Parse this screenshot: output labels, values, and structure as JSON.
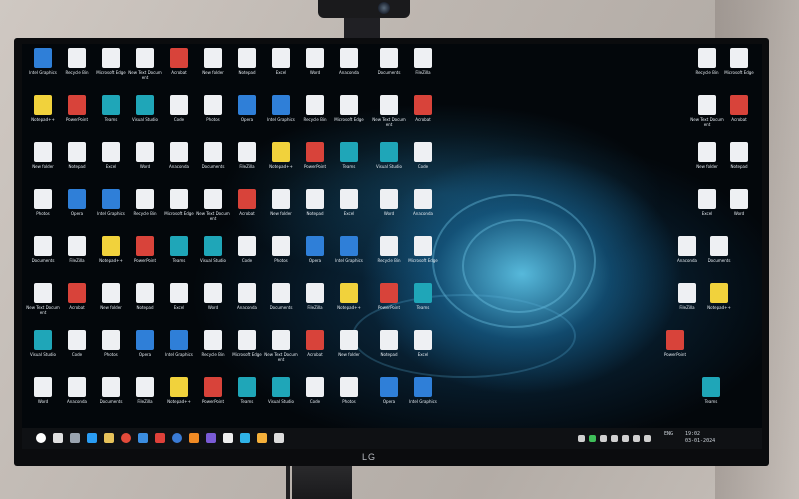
{
  "brand": "LG",
  "taskbar": {
    "icons": [
      {
        "name": "start-icon",
        "color": "#ffffff"
      },
      {
        "name": "search-icon",
        "color": "#e0e0e0"
      },
      {
        "name": "taskview-icon",
        "color": "#9aa4b0"
      },
      {
        "name": "edge-icon",
        "color": "#2a9df4"
      },
      {
        "name": "explorer-icon",
        "color": "#e7c25a"
      },
      {
        "name": "chrome-icon",
        "color": "#e34a3a"
      },
      {
        "name": "mail-icon",
        "color": "#3b8de0"
      },
      {
        "name": "opera-icon",
        "color": "#e0413a"
      },
      {
        "name": "store-icon",
        "color": "#3a7bd5"
      },
      {
        "name": "media-icon",
        "color": "#f08a24"
      },
      {
        "name": "vs-icon",
        "color": "#7a5bd6"
      },
      {
        "name": "app-icon",
        "color": "#eeeeee"
      },
      {
        "name": "browser-icon",
        "color": "#2fb3e8"
      },
      {
        "name": "app2-icon",
        "color": "#f5b03a"
      },
      {
        "name": "app3-icon",
        "color": "#dcdcdc"
      }
    ],
    "tray_icons": [
      {
        "name": "tray-chevron-icon",
        "color": "#d0d0d0"
      },
      {
        "name": "tray-app-icon",
        "color": "#3fbf5a"
      },
      {
        "name": "tray-network-icon",
        "color": "#d0d0d0"
      },
      {
        "name": "tray-volume-icon",
        "color": "#d0d0d0"
      },
      {
        "name": "tray-battery-icon",
        "color": "#d0d0d0"
      },
      {
        "name": "tray-cloud-icon",
        "color": "#d0d0d0"
      },
      {
        "name": "tray-security-icon",
        "color": "#d0d0d0"
      }
    ],
    "lang": "ENG",
    "time": "19:02",
    "date": "03-01-2024"
  },
  "desktop_icons": [
    {
      "label": "Intel Graphics",
      "glyph": "blue"
    },
    {
      "label": "Recycle Bin",
      "glyph": "doc"
    },
    {
      "label": "Microsoft Edge",
      "glyph": "doc"
    },
    {
      "label": "New Text Document",
      "glyph": "doc"
    },
    {
      "label": "Acrobat",
      "glyph": "red"
    },
    {
      "label": "New folder",
      "glyph": "doc"
    },
    {
      "label": "Notepad",
      "glyph": "doc"
    },
    {
      "label": "Excel",
      "glyph": "doc"
    },
    {
      "label": "Word",
      "glyph": "doc"
    },
    {
      "label": "Anaconda",
      "glyph": "doc"
    },
    {
      "label": "Documents",
      "glyph": "doc"
    },
    {
      "label": "FileZilla",
      "glyph": "doc"
    },
    {
      "label": "Notepad++",
      "glyph": "yellow"
    },
    {
      "label": "PowerPoint",
      "glyph": "red"
    },
    {
      "label": "Teams",
      "glyph": "teal"
    },
    {
      "label": "Visual Studio",
      "glyph": "teal"
    },
    {
      "label": "Code",
      "glyph": "doc"
    },
    {
      "label": "Photos",
      "glyph": "doc"
    },
    {
      "label": "Opera",
      "glyph": "blue"
    }
  ]
}
